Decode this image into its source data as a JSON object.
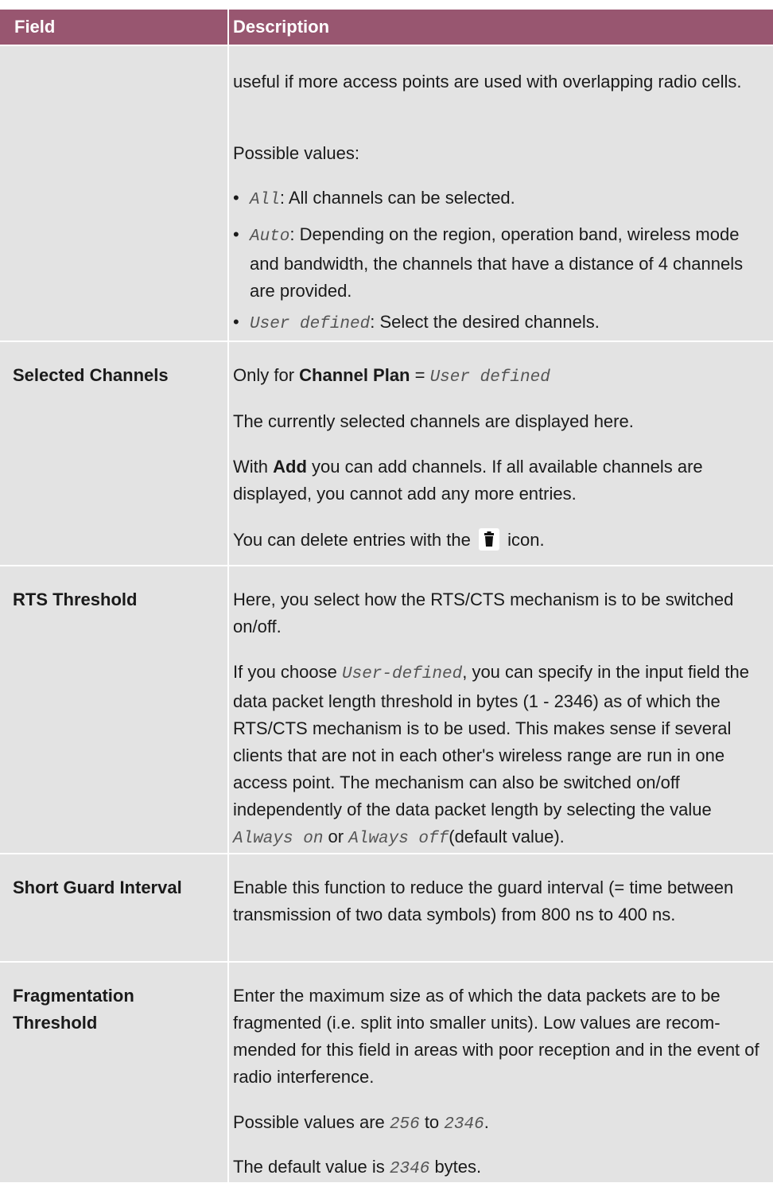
{
  "header": {
    "field": "Field",
    "description": "Description"
  },
  "row1": {
    "continuation": "useful if more access points are used with overlapping radio cells.",
    "possible": "Possible values:",
    "bullets": [
      {
        "value": "All",
        "text": ": All channels can be selected."
      },
      {
        "value": "Auto",
        "text": ": Depending on the region, operation band, wireless mode and bandwidth, the channels that have a distance of 4 channels are provided."
      },
      {
        "value": "User defined",
        "text": ": Select the desired channels."
      }
    ]
  },
  "row2": {
    "label": "Selected Channels",
    "only_pre": "Only for ",
    "only_field": "Channel Plan",
    "only_eq": " = ",
    "only_value": "User defined",
    "p2": "The currently selected channels are displayed here.",
    "p3_pre": "With ",
    "p3_bold": "Add",
    "p3_post": " you can add channels. If all available channels are displayed, you cannot add any more entries.",
    "p4_pre": "You can delete entries with the",
    "p4_icon": "trash-icon",
    "p4_post": "icon."
  },
  "row3": {
    "label": "RTS Threshold",
    "p1": "Here, you select how the RTS/CTS mechanism is to be switched on/off.",
    "p2_pre": "If you choose ",
    "p2_value": "User-defined",
    "p2_mid": ", you can specify in the input field the data packet length threshold in bytes (1 - 2346) as of which the RTS/CTS mechanism is to be used. This makes sense if several clients that are not in each other's wireless range are run in one access point. The mechanism can also be switched on/off independently of the data packet length by selecting the value ",
    "p2_v1": "Always on",
    "p2_or": " or ",
    "p2_v2": "Always off",
    "p2_end": "(default value)."
  },
  "row4": {
    "label": "Short Guard Interval",
    "p1": "Enable this function to reduce the guard interval (= time between transmission of two data symbols) from 800 ns to 400 ns."
  },
  "row5": {
    "label_line1": "Fragmentation",
    "label_line2": "Threshold",
    "p1": "Enter the maximum size as of which the data packets are to be fragmented (i.e. split into smaller units). Low values are recom-mended for this field in areas with poor reception and in the event of radio interference.",
    "p2_pre": "Possible values are ",
    "p2_v1": "256",
    "p2_mid": " to ",
    "p2_v2": "2346",
    "p2_end": ".",
    "p3_pre": "The default value is ",
    "p3_value": "2346",
    "p3_end": " bytes."
  }
}
